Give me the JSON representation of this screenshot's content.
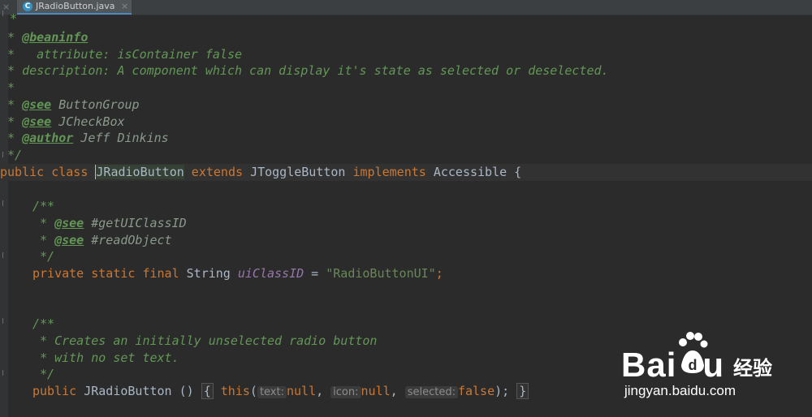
{
  "tab": {
    "pre_close": "×",
    "icon_name": "java-class-icon",
    "icon_glyph": "C",
    "label": "JRadioButton.java",
    "close": "×"
  },
  "code": {
    "l1": "*",
    "l2_star": " * ",
    "l2_tag": "@beaninfo",
    "l3": " *   attribute: isContainer false",
    "l4": " * description: A component which can display it's state as selected or deselected.",
    "l5": " *",
    "l6_star": " * ",
    "l6_tag": "@see",
    "l6_ref": " ButtonGroup",
    "l7_star": " * ",
    "l7_tag": "@see",
    "l7_ref": " JCheckBox",
    "l8_star": " * ",
    "l8_tag": "@author",
    "l8_ref": " Jeff Dinkins",
    "l9": " */",
    "l10_kw1": "public class ",
    "l10_name": "JRadioButton",
    "l10_kw2": " extends ",
    "l10_parent": "JToggleButton",
    "l10_kw3": " implements ",
    "l10_iface": "Accessible {",
    "l11": "/**",
    "l12_star": " * ",
    "l12_tag": "@see",
    "l12_ref": " #getUIClassID",
    "l13_star": " * ",
    "l13_tag": "@see",
    "l13_ref": " #readObject",
    "l14": " */",
    "l15_kw": "private static final ",
    "l15_type": "String ",
    "l15_field": "uiClassID",
    "l15_eq": " = ",
    "l15_str": "\"RadioButtonUI\"",
    "l15_end": ";",
    "l16": "/**",
    "l17": " * Creates an initially unselected radio button",
    "l18": " * with no set text.",
    "l19": " */",
    "l20_kw": "public ",
    "l20_name": "JRadioButton",
    "l20_paren": " () ",
    "l20_open": "{",
    "l20_this": " this",
    "l20_p": "(",
    "l20_hint1": "text:",
    "l20_null1": "null",
    "l20_c1": ", ",
    "l20_hint2": "icon:",
    "l20_null2": "null",
    "l20_c2": ", ",
    "l20_hint3": "selected:",
    "l20_false": "false",
    "l20_end": "); ",
    "l20_close": "}"
  },
  "watermark": {
    "logo": "Bai",
    "logo_end": "u",
    "title": "经验",
    "url": "jingyan.baidu.com"
  },
  "colors": {
    "background": "#2b2b2b",
    "keyword": "#cc7832",
    "doc_comment": "#629755",
    "string": "#6a8759",
    "field": "#9876aa",
    "text": "#a9b7c6"
  }
}
